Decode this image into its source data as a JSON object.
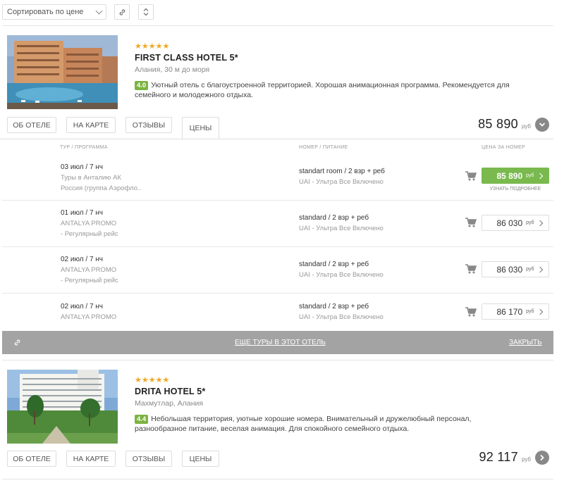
{
  "toolbar": {
    "sort_label": "Сортировать по цене",
    "link_icon": "link-icon",
    "sort_toggle_icon": "sort-arrows-icon"
  },
  "hotels": [
    {
      "stars": "★★★★★",
      "name": "FIRST CLASS HOTEL 5*",
      "location": "Алания, 30 м до моря",
      "rating": "4.0",
      "description": "Уютный отель с благоустроенной территорией. Хорошая анимационная программа. Рекомендуется для семейного и молодежного отдыха.",
      "tabs": [
        "ОБ ОТЕЛЕ",
        "НА КАРТЕ",
        "ОТЗЫВЫ",
        "ЦЕНЫ"
      ],
      "active_tab": "ЦЕНЫ",
      "price": "85 890",
      "currency": "руб"
    },
    {
      "stars": "★★★★★",
      "name": "DRITA HOTEL 5*",
      "location": "Махмутлар, Алания",
      "rating": "4.4",
      "description": "Небольшая территория, уютные хорошие номера. Внимательный и дружелюбный персонал, разнообразное питание, веселая анимация. Для спокойного семейного отдыха.",
      "tabs": [
        "ОБ ОТЕЛЕ",
        "НА КАРТЕ",
        "ОТЗЫВЫ",
        "ЦЕНЫ"
      ],
      "price": "92 117",
      "currency": "руб"
    }
  ],
  "prices_panel": {
    "col_tour": "ТУР / ПРОГРАММА",
    "col_room": "НОМЕР / ПИТАНИЕ",
    "col_price": "ЦЕНА ЗА НОМЕР",
    "offers": [
      {
        "date": "03 июл / 7 нч",
        "program": "Туры в Анталию АК",
        "program2": "Россия (группа Аэрофло..",
        "room": "standart room / 2 взр + реб",
        "meal": "UAI - Ультра Все Включено",
        "price": "85 890",
        "currency": "руб",
        "highlight": true,
        "more": "УЗНАТЬ ПОДРОБНЕЕ"
      },
      {
        "date": "01 июл / 7 нч",
        "program": "ANTALYA PROMO",
        "program2": "- Регулярный рейс",
        "room": "standard / 2 взр + реб",
        "meal": "UAI - Ультра Все Включено",
        "price": "86 030",
        "currency": "руб"
      },
      {
        "date": "02 июл / 7 нч",
        "program": "ANTALYA PROMO",
        "program2": "- Регулярный рейс",
        "room": "standard / 2 взр + реб",
        "meal": "UAI - Ультра Все Включено",
        "price": "86 030",
        "currency": "руб"
      },
      {
        "date": "02 июл / 7 нч",
        "program": "ANTALYA PROMO",
        "room": "standard / 2 взр + реб",
        "meal": "UAI - Ультра Все Включено",
        "price": "86 170",
        "currency": "руб"
      }
    ],
    "more_tours": "ЕЩЕ ТУРЫ В ЭТОТ ОТЕЛЬ",
    "close": "ЗАКРЫТЬ"
  },
  "colors": {
    "accent_green": "#79b94e",
    "rating_green": "#7cb342",
    "star_gold": "#f0a820",
    "bar_grey": "#a3a3a3"
  }
}
